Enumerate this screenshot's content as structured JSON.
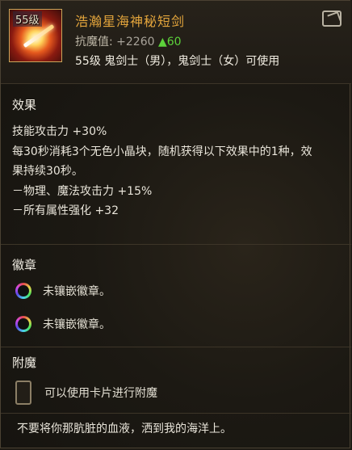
{
  "item": {
    "name": "浩瀚星海神秘短剑",
    "level_badge": "55级",
    "stat_label": "抗魔值:",
    "stat_value": "+2260",
    "stat_delta": "▲60",
    "requirement": "55级 鬼剑士（男），鬼剑士（女）可使用",
    "icon": "short-sword-icon"
  },
  "colors": {
    "item_name": "#e3a53c",
    "stat_up": "#5cd23a"
  },
  "effect": {
    "title": "效果",
    "lines": [
      "技能攻击力 +30%",
      "每30秒消耗3个无色小晶块，随机获得以下效果中的1种，效",
      "果持续30秒。",
      "－物理、魔法攻击力 +15%",
      "－所有属性强化 +32"
    ]
  },
  "emblem": {
    "title": "徽章",
    "slots": [
      {
        "label": "未镶嵌徽章。"
      },
      {
        "label": "未镶嵌徽章。"
      }
    ]
  },
  "enchant": {
    "title": "附魔",
    "slot_label": "可以使用卡片进行附魔"
  },
  "flavor_text": "不要将你那肮脏的血液，洒到我的海洋上。"
}
